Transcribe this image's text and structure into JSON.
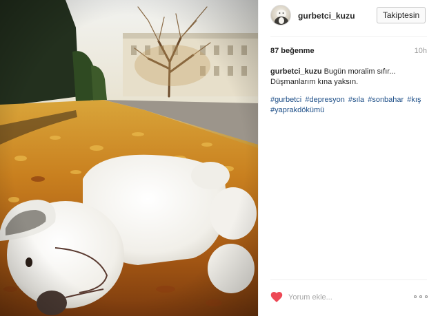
{
  "post": {
    "username": "gurbetci_kuzu",
    "follow_label": "Takiptesin",
    "likes": "87 beğenme",
    "timestamp": "10h",
    "caption_user": "gurbetci_kuzu",
    "caption_text": "Bugün moralim sıfır... Düşmanlarım kına yaksın.",
    "hashtags": [
      "#gurbetci",
      "#depresyon",
      "#sıla",
      "#sonbahar",
      "#kış",
      "#yaprakdökümü"
    ],
    "comment_placeholder": "Yorum ekle..."
  },
  "icons": {
    "like": "heart-icon",
    "options": "more-options-icon",
    "avatar": "avatar-icon"
  },
  "colors": {
    "heart": "#ed4956",
    "hashtag": "#1e4f88",
    "timestamp": "#999999"
  }
}
